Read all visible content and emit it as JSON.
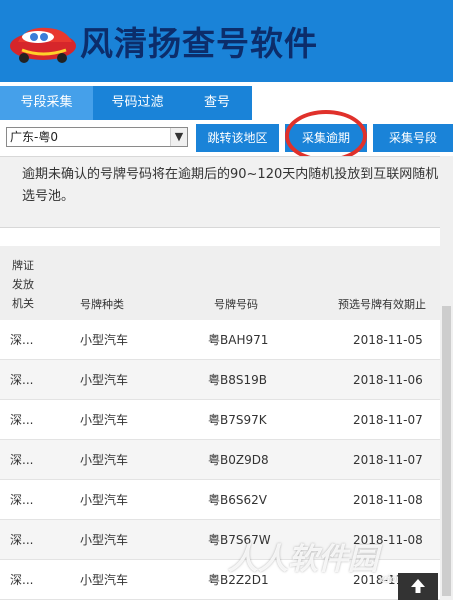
{
  "app": {
    "title": "风清扬查号软件",
    "colors": {
      "header_bg": "#1a83d8",
      "title_text": "#0c2d6b",
      "highlight_ring": "#e0312b"
    },
    "logo_icon": "cartoon-car-icon"
  },
  "tabs": [
    {
      "label": "号段采集",
      "active": true
    },
    {
      "label": "号码过滤",
      "active": false
    },
    {
      "label": "查号",
      "active": false
    }
  ],
  "toolbar": {
    "region_select": {
      "value": "广东-粤0"
    },
    "jump_button": "跳转该地区",
    "collect_overdue_button": "采集逾期",
    "collect_segment_button": "采集号段"
  },
  "notice": {
    "text": "逾期未确认的号牌号码将在逾期后的90~120天内随机投放到互联网随机选号池。"
  },
  "table": {
    "headers": {
      "authority": "牌证发放机关",
      "plate_type": "号牌种类",
      "plate_number": "号牌号码",
      "expiry": "预选号牌有效期止"
    },
    "rows": [
      {
        "authority": "深...",
        "plate_type": "小型汽车",
        "plate_number": "粤BAH971",
        "expiry": "2018-11-05"
      },
      {
        "authority": "深...",
        "plate_type": "小型汽车",
        "plate_number": "粤B8S19B",
        "expiry": "2018-11-06"
      },
      {
        "authority": "深...",
        "plate_type": "小型汽车",
        "plate_number": "粤B7S97K",
        "expiry": "2018-11-07"
      },
      {
        "authority": "深...",
        "plate_type": "小型汽车",
        "plate_number": "粤B0Z9D8",
        "expiry": "2018-11-07"
      },
      {
        "authority": "深...",
        "plate_type": "小型汽车",
        "plate_number": "粤B6S62V",
        "expiry": "2018-11-08"
      },
      {
        "authority": "深...",
        "plate_type": "小型汽车",
        "plate_number": "粤B7S67W",
        "expiry": "2018-11-08"
      },
      {
        "authority": "深...",
        "plate_type": "小型汽车",
        "plate_number": "粤B2Z2D1",
        "expiry": "2018-11-08"
      }
    ]
  },
  "watermark": {
    "text": "人人软件园",
    "sub": "xdown.com"
  },
  "back_to_top_icon": "arrow-up-icon"
}
